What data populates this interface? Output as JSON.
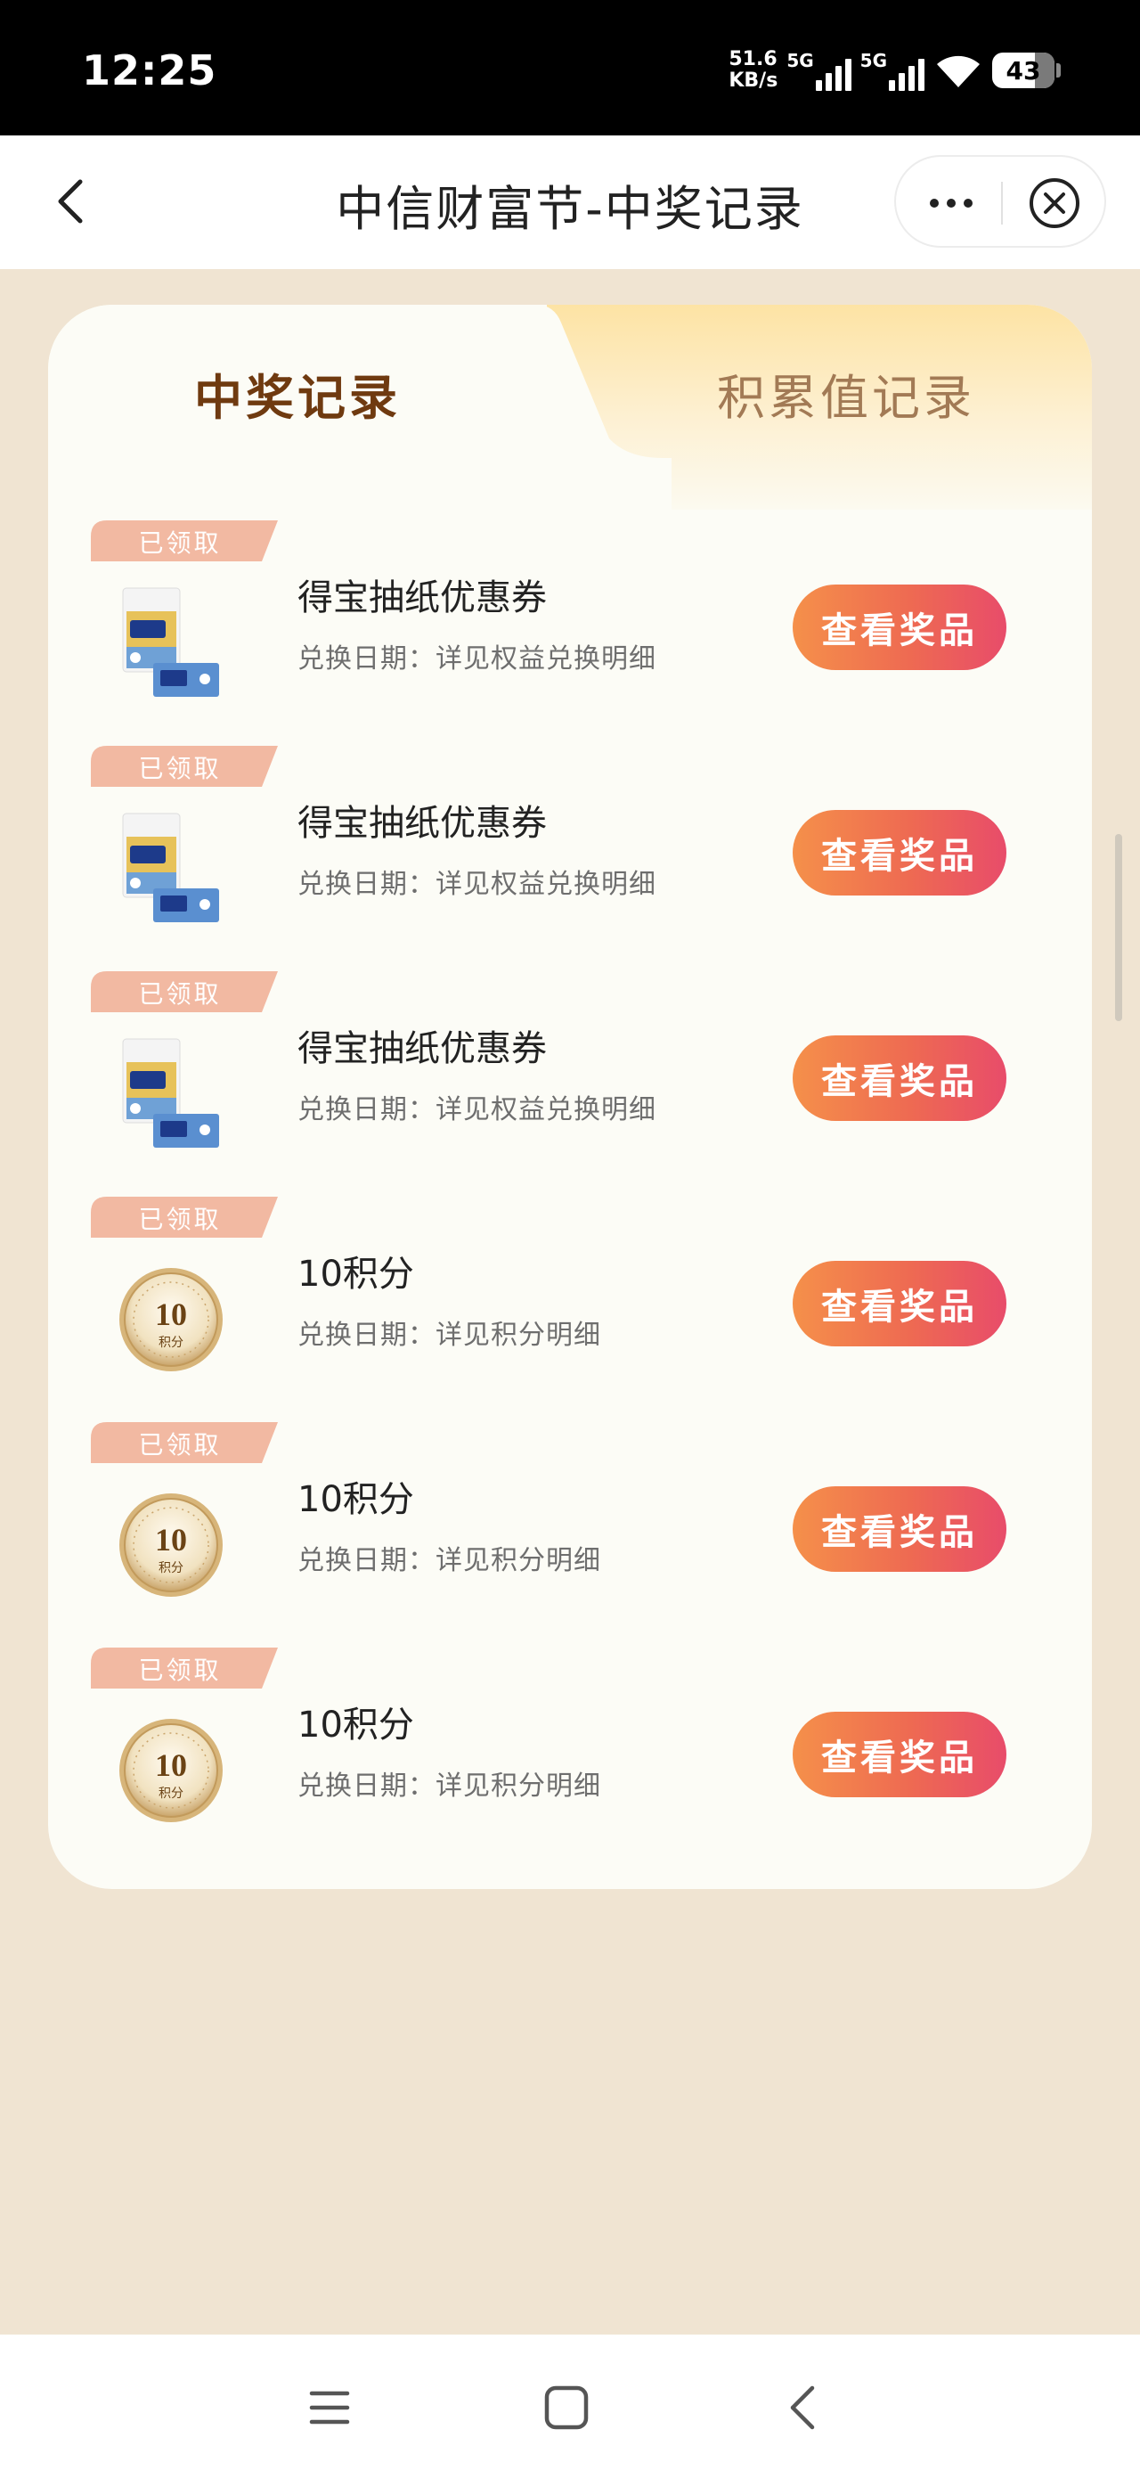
{
  "status_bar": {
    "time": "12:25",
    "net_speed_value": "51.6",
    "net_speed_unit": "KB/s",
    "sim1_label": "5G",
    "sim2_label": "5G",
    "battery": "43"
  },
  "nav": {
    "title": "中信财富节-中奖记录"
  },
  "tabs": [
    {
      "label": "中奖记录",
      "active": true
    },
    {
      "label": "积累值记录",
      "active": false
    }
  ],
  "prizes": [
    {
      "badge": "已领取",
      "name": "得宝抽纸优惠券",
      "date": "兑换日期：详见权益兑换明细",
      "button": "查看奖品",
      "icon": "tissue-pack"
    },
    {
      "badge": "已领取",
      "name": "得宝抽纸优惠券",
      "date": "兑换日期：详见权益兑换明细",
      "button": "查看奖品",
      "icon": "tissue-pack"
    },
    {
      "badge": "已领取",
      "name": "得宝抽纸优惠券",
      "date": "兑换日期：详见权益兑换明细",
      "button": "查看奖品",
      "icon": "tissue-pack"
    },
    {
      "badge": "已领取",
      "name": "10积分",
      "date": "兑换日期：详见积分明细",
      "button": "查看奖品",
      "icon": "points-coin",
      "coin_value": "10",
      "coin_unit": "积分"
    },
    {
      "badge": "已领取",
      "name": "10积分",
      "date": "兑换日期：详见积分明细",
      "button": "查看奖品",
      "icon": "points-coin",
      "coin_value": "10",
      "coin_unit": "积分"
    },
    {
      "badge": "已领取",
      "name": "10积分",
      "date": "兑换日期：详见积分明细",
      "button": "查看奖品",
      "icon": "points-coin",
      "coin_value": "10",
      "coin_unit": "积分"
    }
  ],
  "colors": {
    "page_bg": "#f0e4d2",
    "accent_title": "#6f3a10",
    "button_start": "#f5904a",
    "button_end": "#e84c6a",
    "badge": "#f2b9a2"
  }
}
